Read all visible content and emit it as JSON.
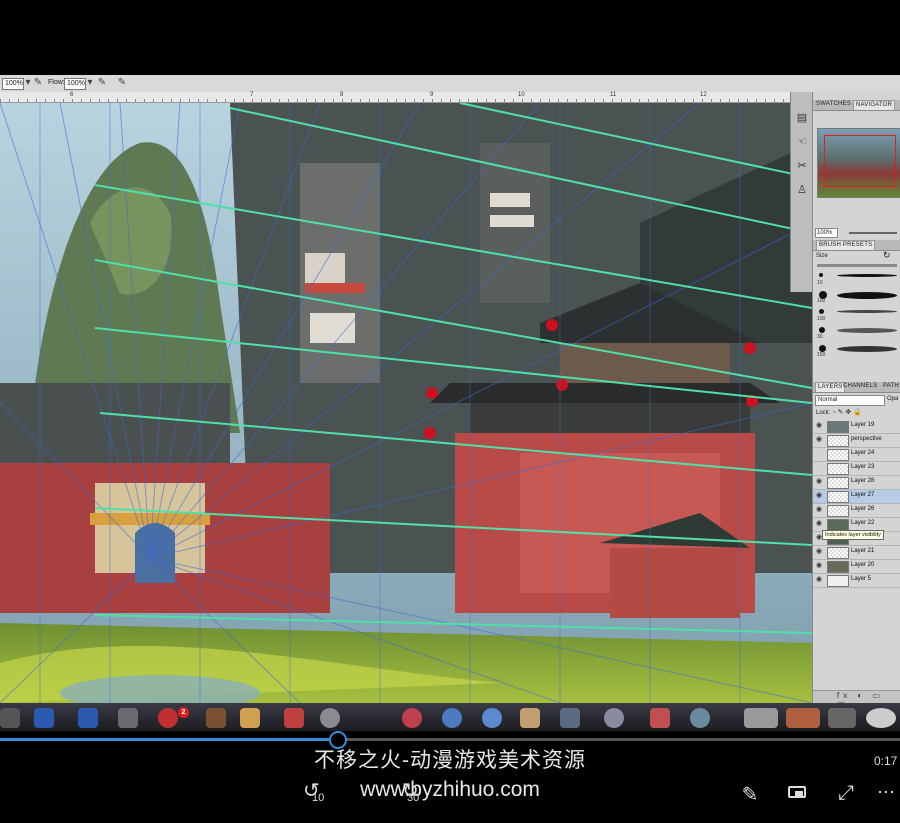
{
  "options_bar": {
    "opacity_value": "100%",
    "flow_label": "Flow:",
    "flow_value": "100%"
  },
  "ruler_ticks": [
    "6",
    "7",
    "8",
    "9",
    "10",
    "11",
    "12"
  ],
  "panels": {
    "swatches_tab": "SWATCHES",
    "navigator_tab": "NAVIGATOR",
    "zoom_value": "100%",
    "brush_presets_tab": "BRUSH PRESETS",
    "size_label": "Size",
    "brushes": [
      {
        "size": "10"
      },
      {
        "size": "100"
      },
      {
        "size": "100"
      },
      {
        "size": "30"
      },
      {
        "size": "150"
      }
    ],
    "layers_tab": "LAYERS",
    "channels_tab": "CHANNELS",
    "paths_tab": "PATH",
    "blend_mode": "Normal",
    "opacity_label": "Opa",
    "lock_label": "Lock:",
    "layers": [
      {
        "name": "Layer 19",
        "selected": false
      },
      {
        "name": "perspective",
        "selected": false
      },
      {
        "name": "Layer 24",
        "selected": false
      },
      {
        "name": "Layer 23",
        "selected": false
      },
      {
        "name": "Layer 28",
        "selected": false
      },
      {
        "name": "Layer 27",
        "selected": true
      },
      {
        "name": "Layer 26",
        "selected": false
      },
      {
        "name": "Layer 22",
        "selected": false
      },
      {
        "name": "mountains",
        "selected": false
      },
      {
        "name": "Layer 21",
        "selected": false
      },
      {
        "name": "Layer 20",
        "selected": false
      },
      {
        "name": "Layer 5",
        "selected": false
      }
    ],
    "tooltip": "Indicates layer visibility"
  },
  "dock": {
    "badge_count": "2"
  },
  "player": {
    "progress": 0.375,
    "time": "0:17",
    "rewind_label": "10",
    "forward_label": "30",
    "watermark_line1": "不移之火-动漫游戏美术资源",
    "watermark_line2": "www.byzhihuo.com"
  },
  "colors": {
    "accent": "#3a8ad8",
    "selected_layer": "#b6cbe6",
    "guide_lines": "#4fe0a8"
  }
}
